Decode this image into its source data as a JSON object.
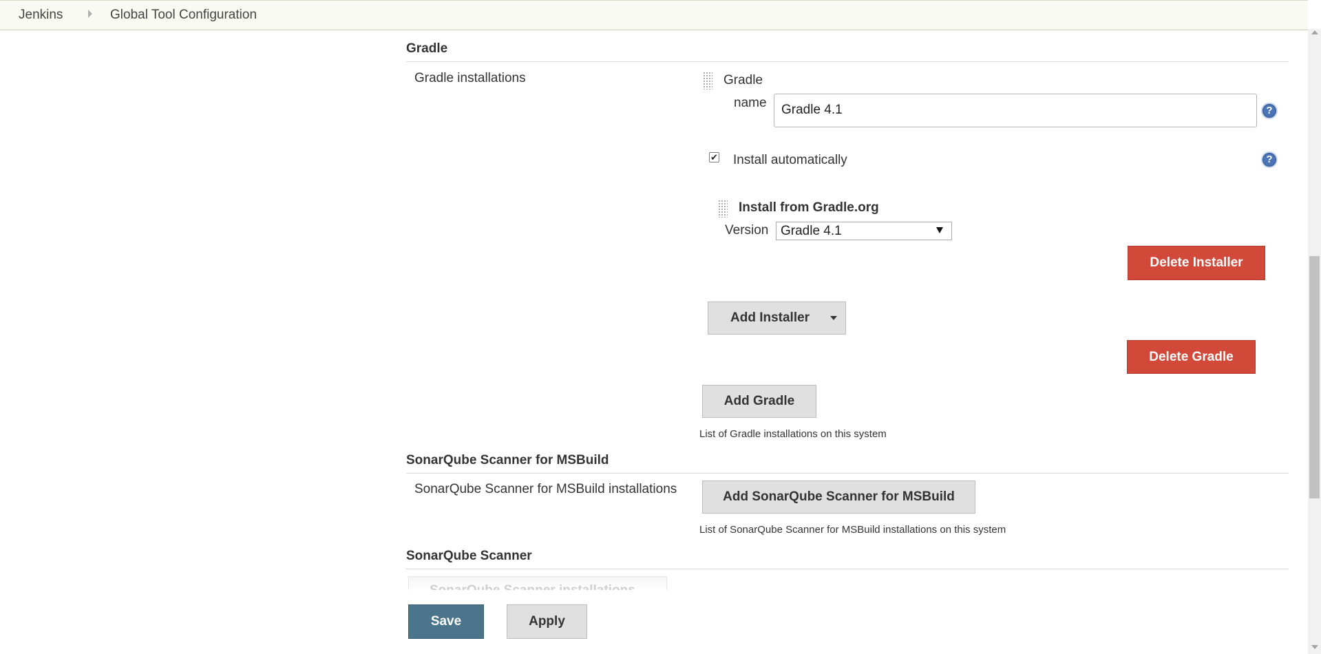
{
  "breadcrumb": {
    "root": "Jenkins",
    "page": "Global Tool Configuration"
  },
  "gradle": {
    "section_title": "Gradle",
    "installations_label": "Gradle installations",
    "item_title": "Gradle",
    "name_label": "name",
    "name_value": "Gradle 4.1",
    "install_auto_label": "Install automatically",
    "install_auto_checked": true,
    "installer_title": "Install from Gradle.org",
    "version_label": "Version",
    "version_value": "Gradle 4.1",
    "delete_installer_label": "Delete Installer",
    "add_installer_label": "Add Installer",
    "delete_gradle_label": "Delete Gradle",
    "add_gradle_label": "Add Gradle",
    "description": "List of Gradle installations on this system"
  },
  "sonar_msbuild": {
    "section_title": "SonarQube Scanner for MSBuild",
    "installations_label": "SonarQube Scanner for MSBuild installations",
    "add_label": "Add SonarQube Scanner for MSBuild",
    "description": "List of SonarQube Scanner for MSBuild installations on this system"
  },
  "sonar_scanner": {
    "section_title": "SonarQube Scanner",
    "partial_button_label": "SonarQube Scanner installations"
  },
  "footer": {
    "save_label": "Save",
    "apply_label": "Apply"
  },
  "colors": {
    "danger": "#d24939",
    "primary": "#4b758b",
    "help": "#4a74b5"
  },
  "icons": {
    "help": "help-icon",
    "drag": "drag-handle-icon",
    "check": "checkmark-icon",
    "dropdown": "chevron-down-icon"
  }
}
